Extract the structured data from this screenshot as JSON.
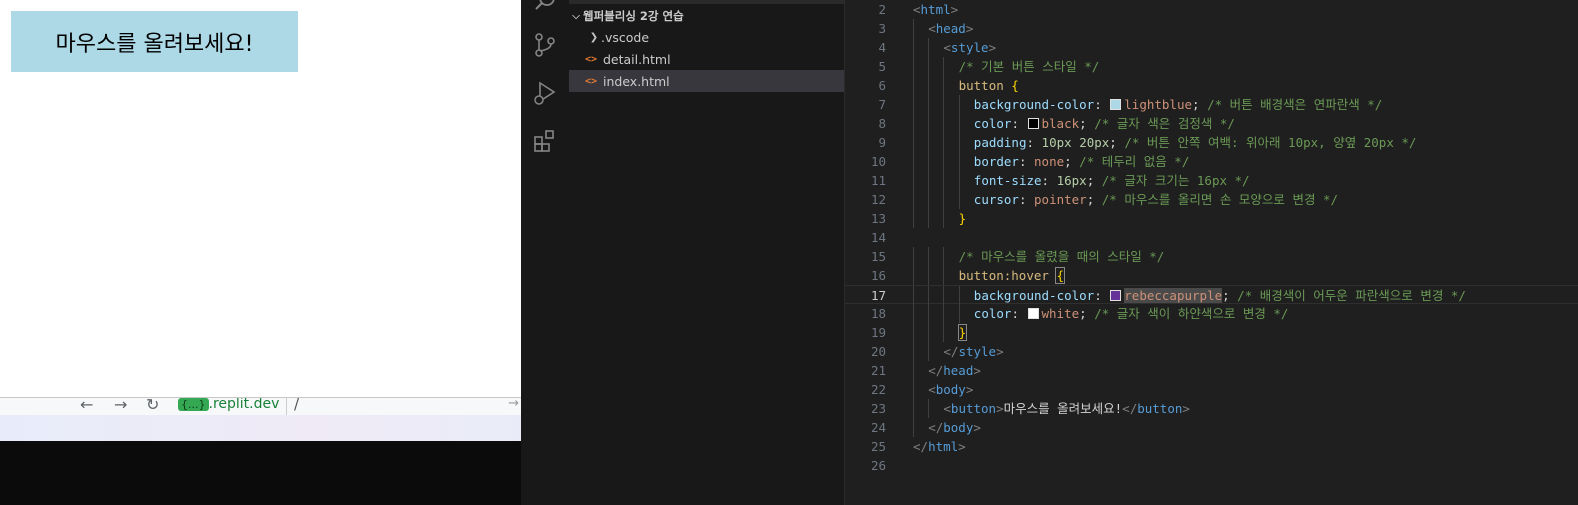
{
  "preview": {
    "button_label": "마우스를 올려보세요!",
    "button_bg": "#add8e6",
    "address_bar": {
      "back_icon": "←",
      "forward_icon": "→",
      "reload_icon": "↻",
      "host_badge": "{...}",
      "host": ".replit.dev",
      "path": "/",
      "go_icon": "→"
    }
  },
  "activity_bar": {
    "icons": [
      "search-icon",
      "source-control-icon",
      "run-debug-icon",
      "extensions-icon"
    ]
  },
  "explorer": {
    "folder": "웹퍼블리싱 2강 연습",
    "items": [
      {
        "label": ".vscode",
        "type": "folder"
      },
      {
        "label": "detail.html",
        "type": "file",
        "icon": "<>"
      },
      {
        "label": "index.html",
        "type": "file",
        "icon": "<>"
      }
    ]
  },
  "editor": {
    "current_line": 17,
    "lines": [
      {
        "n": "2",
        "t": "<html>"
      },
      {
        "n": "3",
        "t": "<head>"
      },
      {
        "n": "4",
        "t": "<style>"
      },
      {
        "n": "5",
        "t": "/* 기본 버튼 스타일 */"
      },
      {
        "n": "6",
        "t": "button {"
      },
      {
        "n": "7",
        "t": "background-color: lightblue; /* 버튼 배경색은 연파란색 */"
      },
      {
        "n": "8",
        "t": "color: black; /* 글자 색은 검정색 */"
      },
      {
        "n": "9",
        "t": "padding: 10px 20px; /* 버튼 안쪽 여백: 위아래 10px, 양옆 20px */"
      },
      {
        "n": "10",
        "t": "border: none; /* 테두리 없음 */"
      },
      {
        "n": "11",
        "t": "font-size: 16px; /* 글자 크기는 16px */"
      },
      {
        "n": "12",
        "t": "cursor: pointer; /* 마우스를 올리면 손 모양으로 변경 */"
      },
      {
        "n": "13",
        "t": "}"
      },
      {
        "n": "14",
        "t": ""
      },
      {
        "n": "15",
        "t": "/* 마우스를 올렸을 때의 스타일 */"
      },
      {
        "n": "16",
        "t": "button:hover {"
      },
      {
        "n": "17",
        "t": "background-color: rebeccapurple; /* 배경색이 어두운 파란색으로 변경 */"
      },
      {
        "n": "18",
        "t": "color: white; /* 글자 색이 하얀색으로 변경 */"
      },
      {
        "n": "19",
        "t": "}"
      },
      {
        "n": "20",
        "t": "</style>"
      },
      {
        "n": "21",
        "t": "</head>"
      },
      {
        "n": "22",
        "t": "<body>"
      },
      {
        "n": "23",
        "t": "<button>마우스를 올려보세요!</button>"
      },
      {
        "n": "24",
        "t": "</body>"
      },
      {
        "n": "25",
        "t": "</html>"
      },
      {
        "n": "26",
        "t": ""
      }
    ],
    "swatches": {
      "lightblue": "#add8e6",
      "black": "#000000",
      "rebeccapurple": "#663399",
      "white": "#ffffff"
    }
  }
}
